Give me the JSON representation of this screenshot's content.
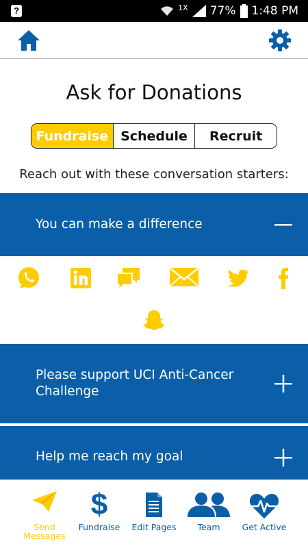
{
  "status_bar": {
    "left_icon": "?",
    "network_badge": "1X",
    "battery": "77%",
    "time": "1:48 PM"
  },
  "header": {
    "home_icon": "home-icon",
    "settings_icon": "gear-icon"
  },
  "title": "Ask for Donations",
  "tabs": [
    {
      "label": "Fundraise",
      "active": true
    },
    {
      "label": "Schedule",
      "active": false
    },
    {
      "label": "Recruit",
      "active": false
    }
  ],
  "subtitle": "Reach out with these conversation starters:",
  "accordion": [
    {
      "text": "You can make a difference",
      "expanded": true,
      "toggle": "minus-icon"
    },
    {
      "text": "Please support UCI Anti-Cancer Challenge",
      "expanded": false,
      "toggle": "plus-icon"
    },
    {
      "text": "Help me reach my goal",
      "expanded": false,
      "toggle": "plus-icon"
    }
  ],
  "share_icons": [
    "whatsapp-icon",
    "linkedin-icon",
    "sms-icon",
    "email-icon",
    "twitter-icon",
    "facebook-icon",
    "snapchat-icon"
  ],
  "bottom_nav": [
    {
      "label": "Send Messages",
      "icon": "paper-plane-icon",
      "active": true
    },
    {
      "label": "Fundraise",
      "icon": "dollar-icon",
      "active": false
    },
    {
      "label": "Edit Pages",
      "icon": "document-icon",
      "active": false
    },
    {
      "label": "Team",
      "icon": "team-icon",
      "active": false
    },
    {
      "label": "Get Active",
      "icon": "heartbeat-icon",
      "active": false
    }
  ],
  "colors": {
    "primary_blue": "#0a5fa8",
    "accent_yellow": "#ffcc00"
  }
}
